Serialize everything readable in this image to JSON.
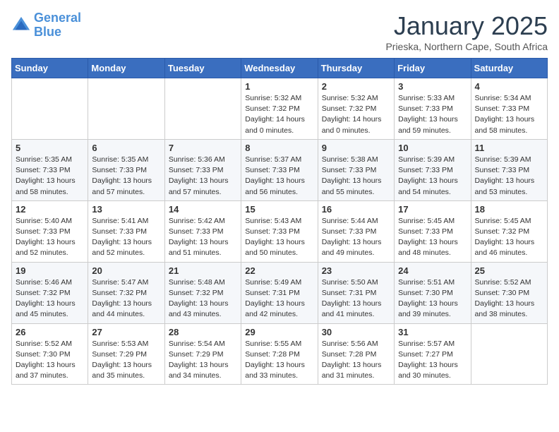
{
  "logo": {
    "line1": "General",
    "line2": "Blue"
  },
  "title": "January 2025",
  "subtitle": "Prieska, Northern Cape, South Africa",
  "weekdays": [
    "Sunday",
    "Monday",
    "Tuesday",
    "Wednesday",
    "Thursday",
    "Friday",
    "Saturday"
  ],
  "weeks": [
    [
      {
        "day": "",
        "info": ""
      },
      {
        "day": "",
        "info": ""
      },
      {
        "day": "",
        "info": ""
      },
      {
        "day": "1",
        "info": "Sunrise: 5:32 AM\nSunset: 7:32 PM\nDaylight: 14 hours\nand 0 minutes."
      },
      {
        "day": "2",
        "info": "Sunrise: 5:32 AM\nSunset: 7:32 PM\nDaylight: 14 hours\nand 0 minutes."
      },
      {
        "day": "3",
        "info": "Sunrise: 5:33 AM\nSunset: 7:33 PM\nDaylight: 13 hours\nand 59 minutes."
      },
      {
        "day": "4",
        "info": "Sunrise: 5:34 AM\nSunset: 7:33 PM\nDaylight: 13 hours\nand 58 minutes."
      }
    ],
    [
      {
        "day": "5",
        "info": "Sunrise: 5:35 AM\nSunset: 7:33 PM\nDaylight: 13 hours\nand 58 minutes."
      },
      {
        "day": "6",
        "info": "Sunrise: 5:35 AM\nSunset: 7:33 PM\nDaylight: 13 hours\nand 57 minutes."
      },
      {
        "day": "7",
        "info": "Sunrise: 5:36 AM\nSunset: 7:33 PM\nDaylight: 13 hours\nand 57 minutes."
      },
      {
        "day": "8",
        "info": "Sunrise: 5:37 AM\nSunset: 7:33 PM\nDaylight: 13 hours\nand 56 minutes."
      },
      {
        "day": "9",
        "info": "Sunrise: 5:38 AM\nSunset: 7:33 PM\nDaylight: 13 hours\nand 55 minutes."
      },
      {
        "day": "10",
        "info": "Sunrise: 5:39 AM\nSunset: 7:33 PM\nDaylight: 13 hours\nand 54 minutes."
      },
      {
        "day": "11",
        "info": "Sunrise: 5:39 AM\nSunset: 7:33 PM\nDaylight: 13 hours\nand 53 minutes."
      }
    ],
    [
      {
        "day": "12",
        "info": "Sunrise: 5:40 AM\nSunset: 7:33 PM\nDaylight: 13 hours\nand 52 minutes."
      },
      {
        "day": "13",
        "info": "Sunrise: 5:41 AM\nSunset: 7:33 PM\nDaylight: 13 hours\nand 52 minutes."
      },
      {
        "day": "14",
        "info": "Sunrise: 5:42 AM\nSunset: 7:33 PM\nDaylight: 13 hours\nand 51 minutes."
      },
      {
        "day": "15",
        "info": "Sunrise: 5:43 AM\nSunset: 7:33 PM\nDaylight: 13 hours\nand 50 minutes."
      },
      {
        "day": "16",
        "info": "Sunrise: 5:44 AM\nSunset: 7:33 PM\nDaylight: 13 hours\nand 49 minutes."
      },
      {
        "day": "17",
        "info": "Sunrise: 5:45 AM\nSunset: 7:33 PM\nDaylight: 13 hours\nand 48 minutes."
      },
      {
        "day": "18",
        "info": "Sunrise: 5:45 AM\nSunset: 7:32 PM\nDaylight: 13 hours\nand 46 minutes."
      }
    ],
    [
      {
        "day": "19",
        "info": "Sunrise: 5:46 AM\nSunset: 7:32 PM\nDaylight: 13 hours\nand 45 minutes."
      },
      {
        "day": "20",
        "info": "Sunrise: 5:47 AM\nSunset: 7:32 PM\nDaylight: 13 hours\nand 44 minutes."
      },
      {
        "day": "21",
        "info": "Sunrise: 5:48 AM\nSunset: 7:32 PM\nDaylight: 13 hours\nand 43 minutes."
      },
      {
        "day": "22",
        "info": "Sunrise: 5:49 AM\nSunset: 7:31 PM\nDaylight: 13 hours\nand 42 minutes."
      },
      {
        "day": "23",
        "info": "Sunrise: 5:50 AM\nSunset: 7:31 PM\nDaylight: 13 hours\nand 41 minutes."
      },
      {
        "day": "24",
        "info": "Sunrise: 5:51 AM\nSunset: 7:30 PM\nDaylight: 13 hours\nand 39 minutes."
      },
      {
        "day": "25",
        "info": "Sunrise: 5:52 AM\nSunset: 7:30 PM\nDaylight: 13 hours\nand 38 minutes."
      }
    ],
    [
      {
        "day": "26",
        "info": "Sunrise: 5:52 AM\nSunset: 7:30 PM\nDaylight: 13 hours\nand 37 minutes."
      },
      {
        "day": "27",
        "info": "Sunrise: 5:53 AM\nSunset: 7:29 PM\nDaylight: 13 hours\nand 35 minutes."
      },
      {
        "day": "28",
        "info": "Sunrise: 5:54 AM\nSunset: 7:29 PM\nDaylight: 13 hours\nand 34 minutes."
      },
      {
        "day": "29",
        "info": "Sunrise: 5:55 AM\nSunset: 7:28 PM\nDaylight: 13 hours\nand 33 minutes."
      },
      {
        "day": "30",
        "info": "Sunrise: 5:56 AM\nSunset: 7:28 PM\nDaylight: 13 hours\nand 31 minutes."
      },
      {
        "day": "31",
        "info": "Sunrise: 5:57 AM\nSunset: 7:27 PM\nDaylight: 13 hours\nand 30 minutes."
      },
      {
        "day": "",
        "info": ""
      }
    ]
  ]
}
